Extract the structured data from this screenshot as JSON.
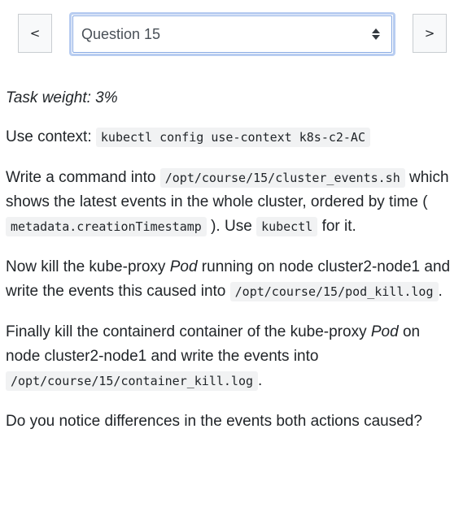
{
  "nav": {
    "prev_label": "<",
    "next_label": ">",
    "select_value": "Question 15"
  },
  "task": {
    "weight_text": "Task weight: 3%",
    "context_prefix": "Use context:",
    "context_cmd": "kubectl config use-context k8s-c2-AC",
    "p1_a": "Write a command into",
    "p1_code1": "/opt/course/15/cluster_events.sh",
    "p1_b": "which shows the latest events in the whole cluster, ordered by time (",
    "p1_code2": "metadata.creationTimestamp",
    "p1_c": "). Use",
    "p1_code3": "kubectl",
    "p1_d": "for it.",
    "p2_a": "Now kill the kube-proxy",
    "p2_em": "Pod",
    "p2_b": "running on node cluster2-node1 and write the events this caused into",
    "p2_code": "/opt/course/15/pod_kill.log",
    "p2_c": ".",
    "p3_a": "Finally kill the containerd container of the kube-proxy",
    "p3_em": "Pod",
    "p3_b": "on node cluster2-node1 and write the events into",
    "p3_code": "/opt/course/15/container_kill.log",
    "p3_c": ".",
    "p4": "Do you notice differences in the events both actions caused?"
  }
}
